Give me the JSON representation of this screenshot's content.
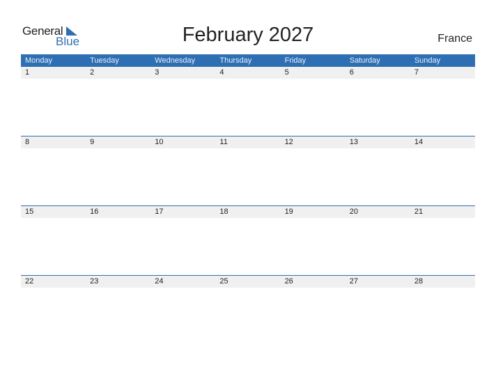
{
  "logo": {
    "general": "General",
    "blue": "Blue",
    "icon": "logo-triangle-icon"
  },
  "title": "February 2027",
  "country": "France",
  "colors": {
    "accent": "#2e6fb3",
    "date_strip": "#f0f0f0"
  },
  "weekdays": [
    "Monday",
    "Tuesday",
    "Wednesday",
    "Thursday",
    "Friday",
    "Saturday",
    "Sunday"
  ],
  "weeks": [
    [
      "1",
      "2",
      "3",
      "4",
      "5",
      "6",
      "7"
    ],
    [
      "8",
      "9",
      "10",
      "11",
      "12",
      "13",
      "14"
    ],
    [
      "15",
      "16",
      "17",
      "18",
      "19",
      "20",
      "21"
    ],
    [
      "22",
      "23",
      "24",
      "25",
      "26",
      "27",
      "28"
    ]
  ]
}
